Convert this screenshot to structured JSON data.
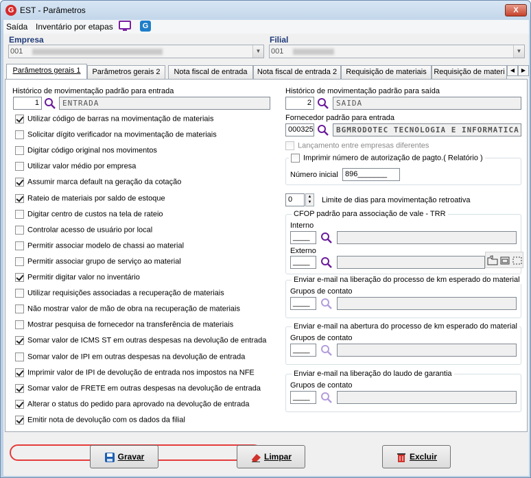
{
  "window": {
    "title": "EST - Parâmetros",
    "close_label": "X",
    "app_icon": "G"
  },
  "menu": {
    "items": [
      "Saída",
      "Inventário por etapas"
    ],
    "g_icon": "G"
  },
  "header": {
    "empresa_label": "Empresa",
    "empresa_value": "001",
    "filial_label": "Filial",
    "filial_value": "001"
  },
  "tabs": [
    {
      "label": "Parâmetros gerais 1",
      "active": true
    },
    {
      "label": "Parâmetros gerais 2",
      "active": false
    },
    {
      "label": "Nota fiscal de entrada",
      "active": false
    },
    {
      "label": "Nota fiscal de entrada 2",
      "active": false
    },
    {
      "label": "Requisição de materiais",
      "active": false
    },
    {
      "label": "Requisição de materi",
      "active": false
    }
  ],
  "left": {
    "hist_entrada_label": "Histórico de movimentação padrão para entrada",
    "hist_entrada_code": "1",
    "hist_entrada_desc": "ENTRADA",
    "checkboxes": [
      {
        "label": "Utilizar código de barras na movimentação de materiais",
        "checked": true
      },
      {
        "label": "Solicitar dígito verificador na movimentação de materiais",
        "checked": false
      },
      {
        "label": "Digitar código original nos movimentos",
        "checked": false
      },
      {
        "label": "Utilizar valor médio por empresa",
        "checked": false
      },
      {
        "label": "Assumir marca default na geração da cotação",
        "checked": true
      },
      {
        "label": "Rateio de materiais por saldo de estoque",
        "checked": true
      },
      {
        "label": "Digitar centro de custos na tela de rateio",
        "checked": false
      },
      {
        "label": "Controlar acesso de usuário por local",
        "checked": false
      },
      {
        "label": "Permitir associar modelo de chassi ao material",
        "checked": false
      },
      {
        "label": "Permitir associar grupo de serviço ao material",
        "checked": false
      },
      {
        "label": "Permitir digitar valor no inventário",
        "checked": true
      },
      {
        "label": "Utilizar requisições associadas a recuperação de materiais",
        "checked": false
      },
      {
        "label": "Não mostrar valor de mão de obra na recuperação de materiais",
        "checked": false
      },
      {
        "label": "Mostrar pesquisa de fornecedor na transferência de materiais",
        "checked": false
      },
      {
        "label": "Somar valor de ICMS ST em outras despesas na devolução de entrada",
        "checked": true
      },
      {
        "label": "Somar valor de IPI em outras despesas na devolução de entrada",
        "checked": false
      },
      {
        "label": "Imprimir valor de IPI de devolução de entrada nos impostos na NFE",
        "checked": true
      },
      {
        "label": "Somar valor de FRETE em outras despesas na devolução de entrada",
        "checked": true
      },
      {
        "label": "Alterar o status do pedido para aprovado na devolução de entrada",
        "checked": true
      },
      {
        "label": "Emitir nota de devolução com os dados da filial",
        "checked": true
      }
    ]
  },
  "right": {
    "hist_saida_label": "Histórico de movimentação padrão para saída",
    "hist_saida_code": "2",
    "hist_saida_desc": "SAIDA",
    "fornecedor_label": "Fornecedor padrão para entrada",
    "fornecedor_code": "000325",
    "fornecedor_desc": "BGMRODOTEC TECNOLOGIA E INFORMATICA",
    "lanc_entre_empresas": "Lançamento entre empresas diferentes",
    "imprimir_autorizacao": "Imprimir número de autorização de pagto.( Relatório )",
    "numero_inicial_label": "Número inicial",
    "numero_inicial_value": "896_______",
    "limite_dias_value": "0",
    "limite_dias_label": "Limite de dias para movimentação retroativa",
    "cfop_title": "CFOP padrão para associação de vale - TRR",
    "interno_label": "Interno",
    "interno_value": "____",
    "externo_label": "Externo",
    "externo_value": "____",
    "email_groups": [
      {
        "title": "Enviar e-mail na liberação do processo de km esperado do material",
        "sub": "Grupos de contato",
        "value": "____"
      },
      {
        "title": "Enviar e-mail na abertura do processo de km esperado do material",
        "sub": "Grupos de contato",
        "value": "____"
      },
      {
        "title": "Enviar e-mail na liberação do laudo de garantia",
        "sub": "Grupos de contato",
        "value": "____"
      }
    ]
  },
  "buttons": {
    "gravar": "Gravar",
    "limpar": "Limpar",
    "excluir": "Excluir"
  },
  "colors": {
    "accent": "#1f3a78",
    "highlight": "#e53a3a",
    "search": "#6a1b9a"
  }
}
